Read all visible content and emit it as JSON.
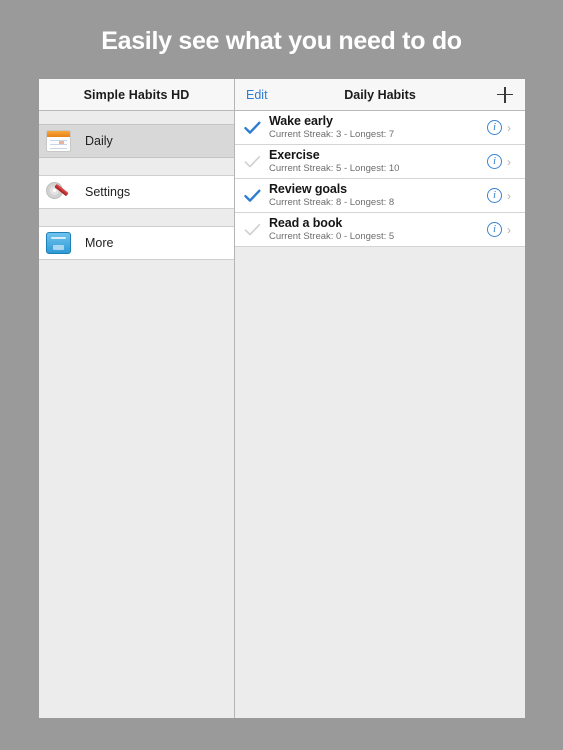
{
  "headline": "Easily see what you need to do",
  "colors": {
    "background": "#9a9a9a",
    "headline_text": "#ffffff",
    "accent_blue": "#3a84cd",
    "edit_link": "#2f7dd1",
    "check_done": "#2f7dd1",
    "check_pending": "#cfcfcf",
    "panel_bg": "#ececec",
    "row_bg": "#ffffff",
    "selected_row_bg": "#d8d8d8"
  },
  "sidebar": {
    "title": "Simple Habits HD",
    "items": [
      {
        "label": "Daily",
        "icon": "calendar-icon",
        "selected": true
      },
      {
        "label": "Settings",
        "icon": "gear-screwdriver-icon",
        "selected": false
      },
      {
        "label": "More",
        "icon": "blue-box-icon",
        "selected": false
      }
    ]
  },
  "detail": {
    "edit_label": "Edit",
    "title": "Daily Habits",
    "add_label": "+",
    "info_glyph": "i",
    "chevron_glyph": "›",
    "habits": [
      {
        "name": "Wake early",
        "streak_text": "Current Streak: 3 - Longest: 7",
        "current_streak": 3,
        "longest_streak": 7,
        "completed": true
      },
      {
        "name": "Exercise",
        "streak_text": "Current Streak: 5 - Longest: 10",
        "current_streak": 5,
        "longest_streak": 10,
        "completed": false
      },
      {
        "name": "Review goals",
        "streak_text": "Current Streak: 8 - Longest: 8",
        "current_streak": 8,
        "longest_streak": 8,
        "completed": true
      },
      {
        "name": "Read a book",
        "streak_text": "Current Streak: 0 - Longest: 5",
        "current_streak": 0,
        "longest_streak": 5,
        "completed": false
      }
    ]
  }
}
